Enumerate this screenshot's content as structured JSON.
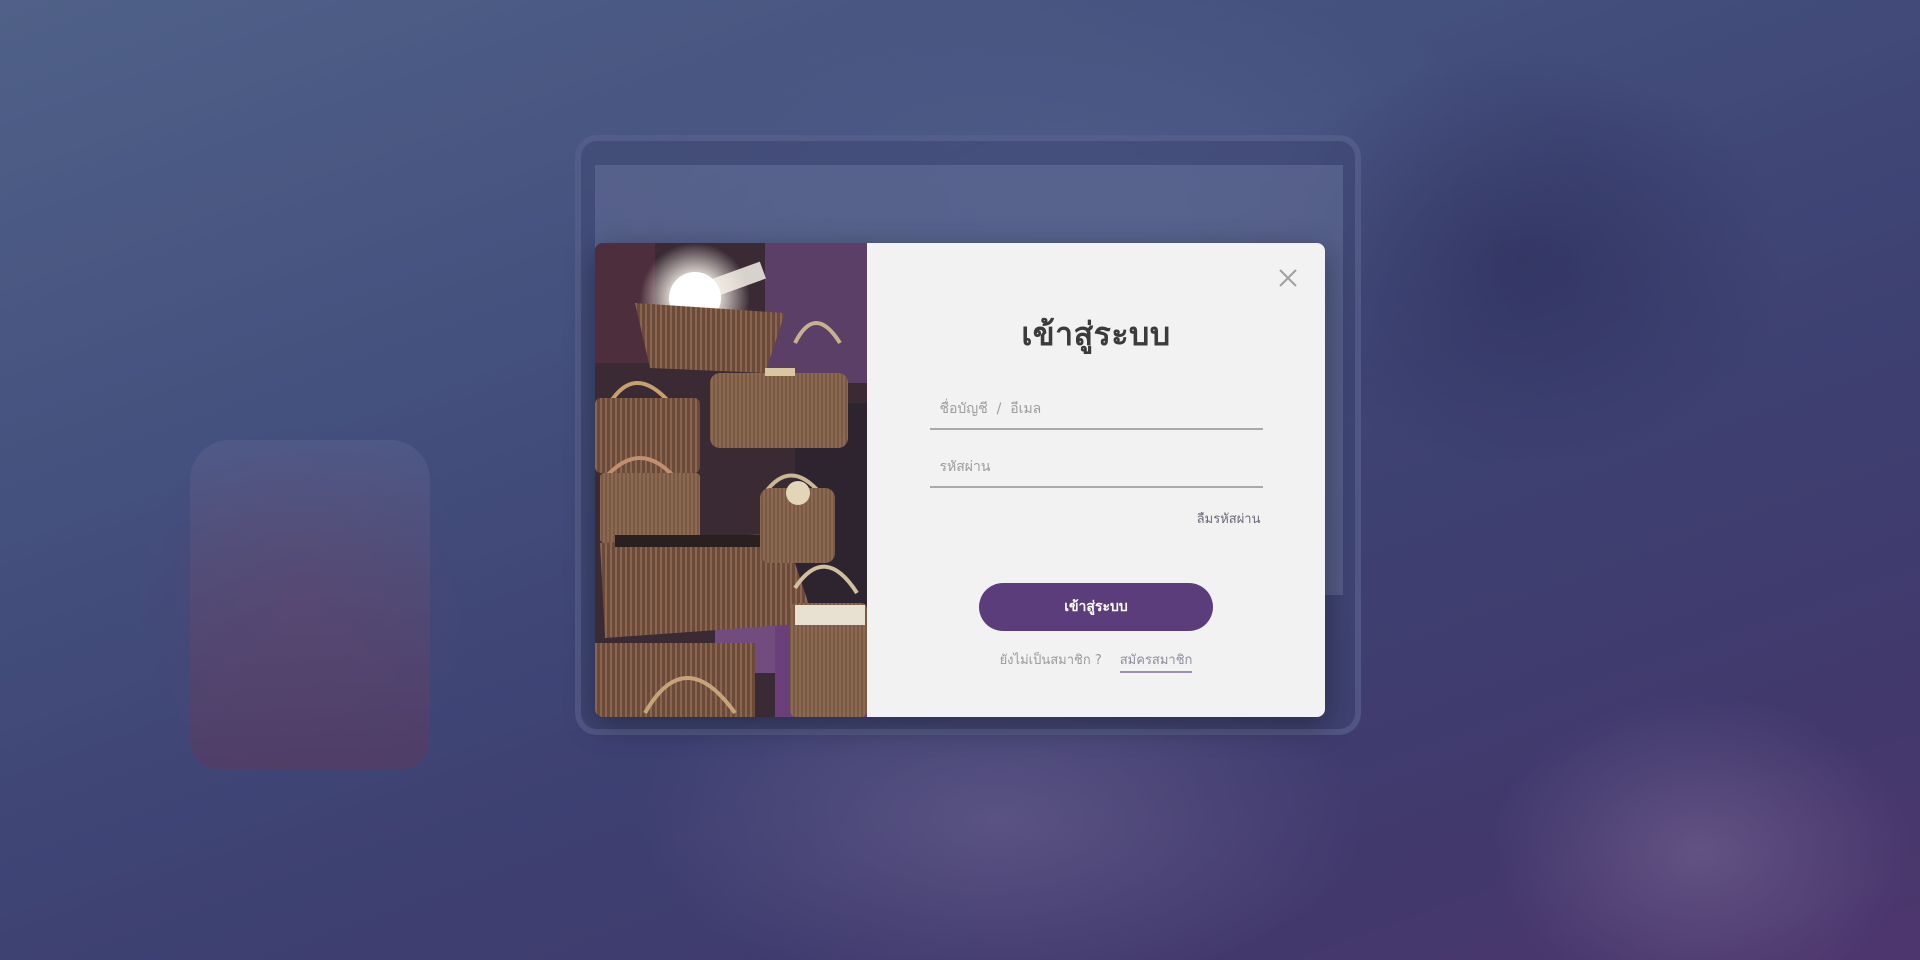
{
  "login": {
    "title": "เข้าสู่ระบบ",
    "username_placeholder": "ชื่อบัญชี  /  อีเมล",
    "password_placeholder": "รหัสผ่าน",
    "forgot_password": "ลืมรหัสผ่าน",
    "submit_label": "เข้าสู่ระบบ",
    "not_member_text": "ยังไม่เป็นสมาชิก ?",
    "signup_link": "สมัครสมาชิก"
  },
  "icons": {
    "close": "close-icon"
  },
  "colors": {
    "accent": "#5a3d7a",
    "form_background": "#f2f2f2",
    "title_text": "#3b3b3b"
  }
}
